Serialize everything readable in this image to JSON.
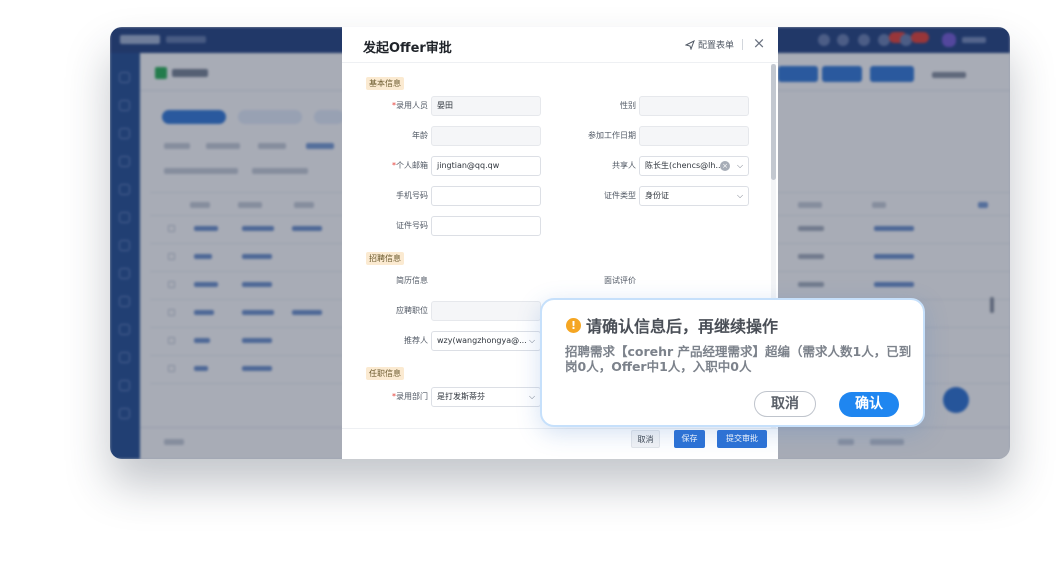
{
  "dialog": {
    "title": "发起Offer审批",
    "config_label": "配置表单",
    "close_glyph": "×",
    "sections": {
      "basic": "基本信息",
      "recruit": "招聘信息",
      "onboard": "任职信息"
    },
    "fields": {
      "hire_person": {
        "label": "录用人员",
        "value": "晏田"
      },
      "gender": {
        "label": "性别",
        "value": ""
      },
      "age": {
        "label": "年龄",
        "value": ""
      },
      "work_start_date": {
        "label": "参加工作日期",
        "value": ""
      },
      "email": {
        "label": "个人邮箱",
        "value": "jingtian@qq.qw"
      },
      "share_person": {
        "label": "共享人",
        "value": "陈长生(chencs@lh..."
      },
      "phone": {
        "label": "手机号码",
        "value": ""
      },
      "id_type": {
        "label": "证件类型",
        "value": "身份证"
      },
      "id_number": {
        "label": "证件号码",
        "value": ""
      },
      "resume": {
        "label": "简历信息",
        "value": ""
      },
      "interview_eval": {
        "label": "面试评价",
        "value": ""
      },
      "position": {
        "label": "应聘职位",
        "value": ""
      },
      "referrer": {
        "label": "推荐人",
        "value": "wzy(wangzhongya@..."
      },
      "hire_dept": {
        "label": "录用部门",
        "value": "是打发斯蒂芬"
      }
    },
    "required_mark": "*",
    "footer": {
      "cancel": "取消",
      "save": "保存",
      "submit": "提交审批"
    }
  },
  "confirm": {
    "icon": "!",
    "title": "请确认信息后，再继续操作",
    "message": "招聘需求【corehr 产品经理需求】超编（需求人数1人，已到岗0人，Offer中1人，入职中0人",
    "cancel": "取消",
    "ok": "确认"
  },
  "colors": {
    "primary": "#2d72d6",
    "confirm_ok": "#1f86f0",
    "warning": "#f5a623",
    "required": "#e5403a",
    "section_bg": "#fbead1",
    "top_bar": "#2c4a86"
  },
  "icons": {
    "config": "paper-plane-icon",
    "close": "close-icon",
    "warning": "warning-icon",
    "dropdown": "chevron-down-icon",
    "clear": "clear-icon"
  }
}
